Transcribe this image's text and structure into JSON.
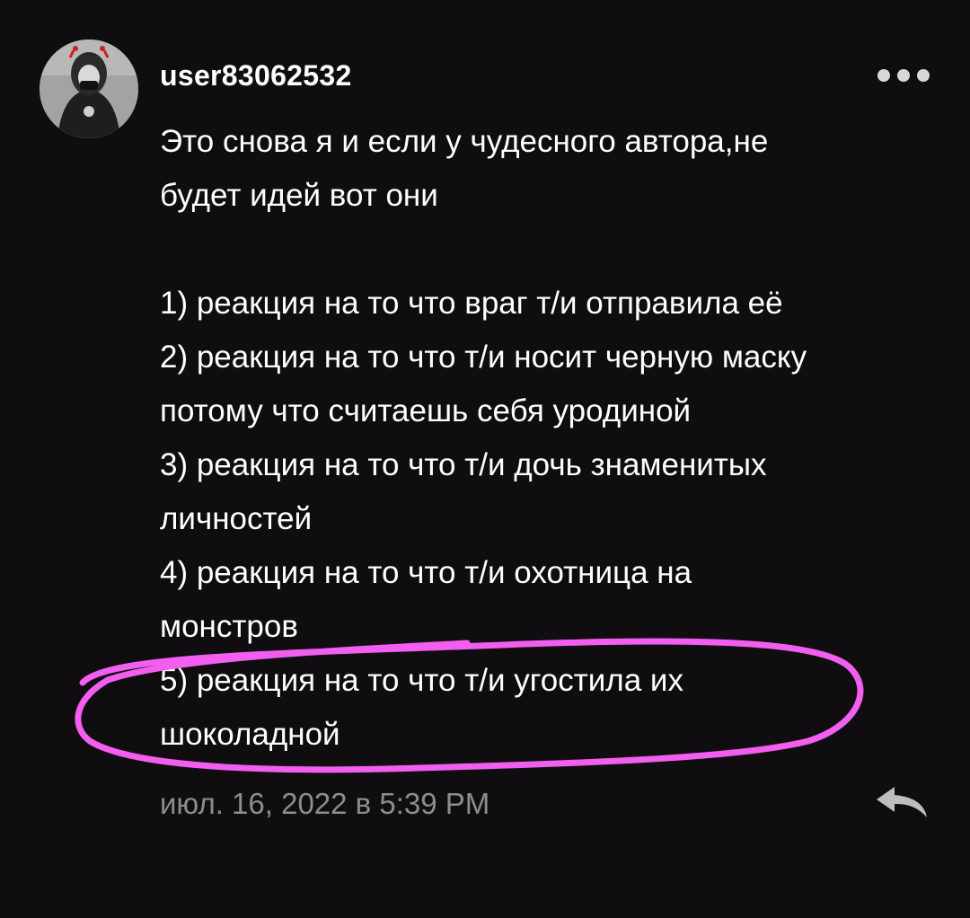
{
  "comment": {
    "username": "user83062532",
    "avatar_icon": "avatar-image",
    "more_icon": "more-options-icon",
    "reply_icon": "reply-arrow-icon",
    "lines": [
      "Это снова я и если у чудесного автора,не",
      "будет идей вот они",
      "",
      "1) реакция на то что враг т/и отправила её",
      "2) реакция на то что т/и носит черную маску",
      "потому что считаешь себя уродиной",
      "3) реакция на то что т/и дочь знаменитых",
      "личностей",
      "4) реакция на то что т/и охотница на",
      "монстров",
      "5) реакция на то что т/и угостила их",
      "шоколадной"
    ],
    "timestamp": "июл. 16, 2022 в 5:39 PM"
  },
  "colors": {
    "background": "#0f0d10",
    "text": "#ffffff",
    "muted": "#8d8d8d",
    "highlight": "#f25ff0"
  }
}
